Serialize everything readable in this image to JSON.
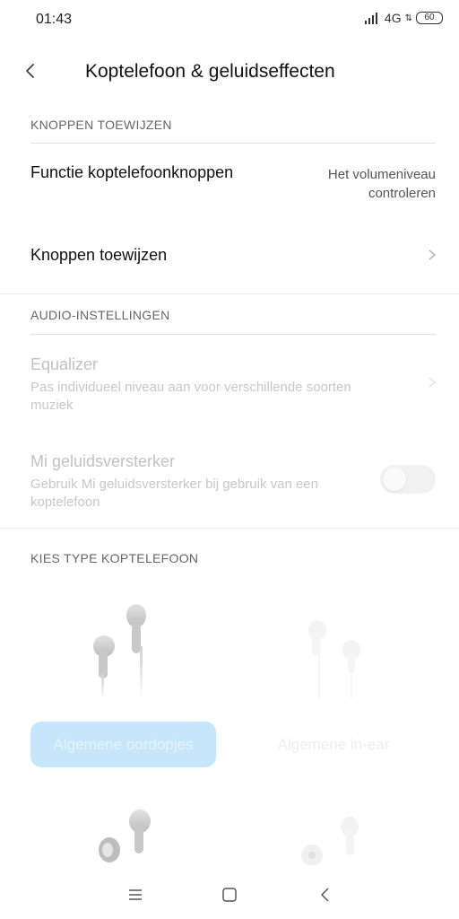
{
  "status_bar": {
    "time": "01:43",
    "network": "4G",
    "battery": "60"
  },
  "header": {
    "title": "Koptelefoon & geluidseffecten"
  },
  "sections": {
    "buttons": {
      "heading": "KNOPPEN TOEWIJZEN",
      "function_label": "Functie koptelefoonknoppen",
      "function_value": "Het volumeniveau controleren",
      "assign_label": "Knoppen toewijzen"
    },
    "audio": {
      "heading": "AUDIO-INSTELLINGEN",
      "equalizer_label": "Equalizer",
      "equalizer_sub": "Pas individueel niveau aan voor verschillende soorten muziek",
      "amp_label": "Mi geluidsversterker",
      "amp_sub": "Gebruik Mi geluidsversterker bij gebruik van een koptelefoon",
      "amp_on": false
    },
    "type": {
      "heading": "KIES TYPE KOPTELEFOON",
      "option1": "Algemene oordopjes",
      "option2": "Algemene in-ear",
      "selected": "Algemene oordopjes"
    }
  },
  "colors": {
    "accent": "#c5e6fb",
    "disabled": "#c2c2c2"
  },
  "icons": {
    "back": "back-arrow-icon",
    "chevron": "chevron-right-icon",
    "nav": [
      "menu-icon",
      "home-icon",
      "back-icon"
    ]
  }
}
